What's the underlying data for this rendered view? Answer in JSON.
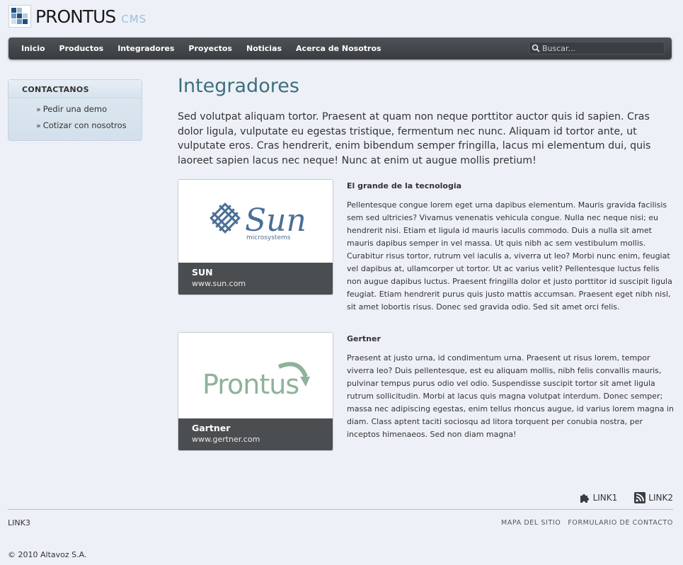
{
  "brand": {
    "name": "PRONTUS",
    "suffix": "CMS"
  },
  "nav": {
    "items": [
      "Inicio",
      "Productos",
      "Integradores",
      "Proyectos",
      "Noticias",
      "Acerca de Nosotros"
    ],
    "search_placeholder": "Buscar..."
  },
  "sidebar": {
    "title": "CONTACTANOS",
    "items": [
      {
        "label": "Pedir una demo"
      },
      {
        "label": "Cotizar con nosotros"
      }
    ]
  },
  "main": {
    "title": "Integradores",
    "intro": "Sed volutpat aliquam tortor. Praesent at quam non neque porttitor auctor quis id sapien. Cras dolor ligula, vulputate eu egestas tristique, fermentum nec nunc. Aliquam id tortor ante, ut vulputate eros. Cras hendrerit, enim bibendum semper fringilla, lacus mi elementum dui, quis laoreet sapien lacus nec neque! Nunc at enim ut augue mollis pretium!",
    "entries": [
      {
        "card_name": "SUN",
        "card_url": "www.sun.com",
        "logo_text": "Sun",
        "logo_subtext": "microsystems",
        "title": "El grande de la tecnologia",
        "body": "Pellentesque congue lorem eget urna dapibus elementum. Mauris gravida facilisis sem sed ultricies? Vivamus venenatis vehicula congue. Nulla nec neque nisi; eu hendrerit nisi. Etiam et ligula id mauris iaculis commodo. Duis a nulla sit amet mauris dapibus semper in vel massa. Ut quis nibh ac sem vestibulum mollis. Curabitur risus tortor, rutrum vel iaculis a, viverra ut leo? Morbi nunc enim, feugiat vel dapibus at, ullamcorper ut tortor. Ut ac varius velit? Pellentesque luctus felis non augue dapibus luctus. Praesent fringilla dolor et justo porttitor id suscipit ligula feugiat. Etiam hendrerit purus quis justo mattis accumsan. Praesent eget nibh nisl, sit amet lobortis risus. Donec sed gravida odio. Sed sit amet orci felis."
      },
      {
        "card_name": "Gartner",
        "card_url": "www.gertner.com",
        "logo_text": "Prontus",
        "title": "Gertner",
        "body": "Praesent at justo urna, id condimentum urna. Praesent ut risus lorem, tempor viverra leo? Duis pellentesque, est eu aliquam mollis, nibh felis convallis mauris, pulvinar tempus purus odio vel odio. Suspendisse suscipit tortor sit amet ligula rutrum sollicitudin. Morbi at lacus quis magna volutpat interdum. Donec semper; massa nec adipiscing egestas, enim tellus rhoncus augue, id varius lorem magna in diam. Class aptent taciti sociosqu ad litora torquent per conubia nostra, per inceptos himenaeos. Sed non diam magna!"
      }
    ]
  },
  "footer": {
    "link1": "LINK1",
    "link2": "LINK2",
    "link3": "LINK3",
    "nav": [
      "MAPA DEL SITIO",
      "FORMULARIO DE CONTACTO"
    ],
    "copyright": "© 2010 Altavoz S.A."
  },
  "colors": {
    "accent_title": "#3e6f7d",
    "nav_bg": "#45494c",
    "logo_blue": "#3b6e9b",
    "sun_blue": "#4a6f96",
    "prontus_green": "#8fb29a"
  }
}
